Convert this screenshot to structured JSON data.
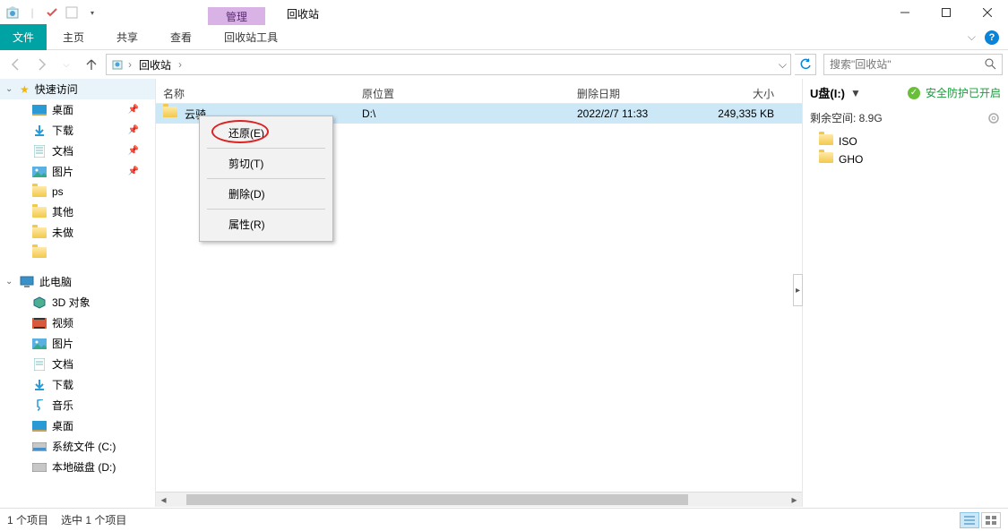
{
  "title_bar": {
    "context_tab": "管理",
    "location_tab": "回收站"
  },
  "ribbon": {
    "file": "文件",
    "home": "主页",
    "share": "共享",
    "view": "查看",
    "tools": "回收站工具"
  },
  "nav": {
    "crumb": "回收站",
    "sep": "›",
    "search_placeholder": "搜索\"回收站\""
  },
  "sidebar": {
    "quick": "快速访问",
    "items": [
      "桌面",
      "下载",
      "文档",
      "图片",
      "ps",
      "其他",
      "未做",
      ""
    ],
    "thispc": "此电脑",
    "pc_items": [
      "3D 对象",
      "视频",
      "图片",
      "文档",
      "下载",
      "音乐",
      "桌面",
      "系统文件 (C:)",
      "本地磁盘 (D:)"
    ]
  },
  "columns": {
    "name": "名称",
    "orig": "原位置",
    "deleted": "删除日期",
    "size": "大小"
  },
  "row": {
    "name": "云骑",
    "orig": "D:\\",
    "deleted": "2022/2/7 11:33",
    "size": "249,335 KB"
  },
  "context": {
    "restore": "还原(E)",
    "cut": "剪切(T)",
    "delete": "删除(D)",
    "props": "属性(R)"
  },
  "right": {
    "drive": "U盘(I:)",
    "security": "安全防护已开启",
    "space": "剩余空间: 8.9G",
    "folders": [
      "ISO",
      "GHO"
    ]
  },
  "status": {
    "items": "1 个项目",
    "selected": "选中 1 个项目"
  },
  "glyphs": {
    "arrow_down": "▼",
    "arrow_right": "›",
    "arrow_left": "‹",
    "check": "✓"
  }
}
